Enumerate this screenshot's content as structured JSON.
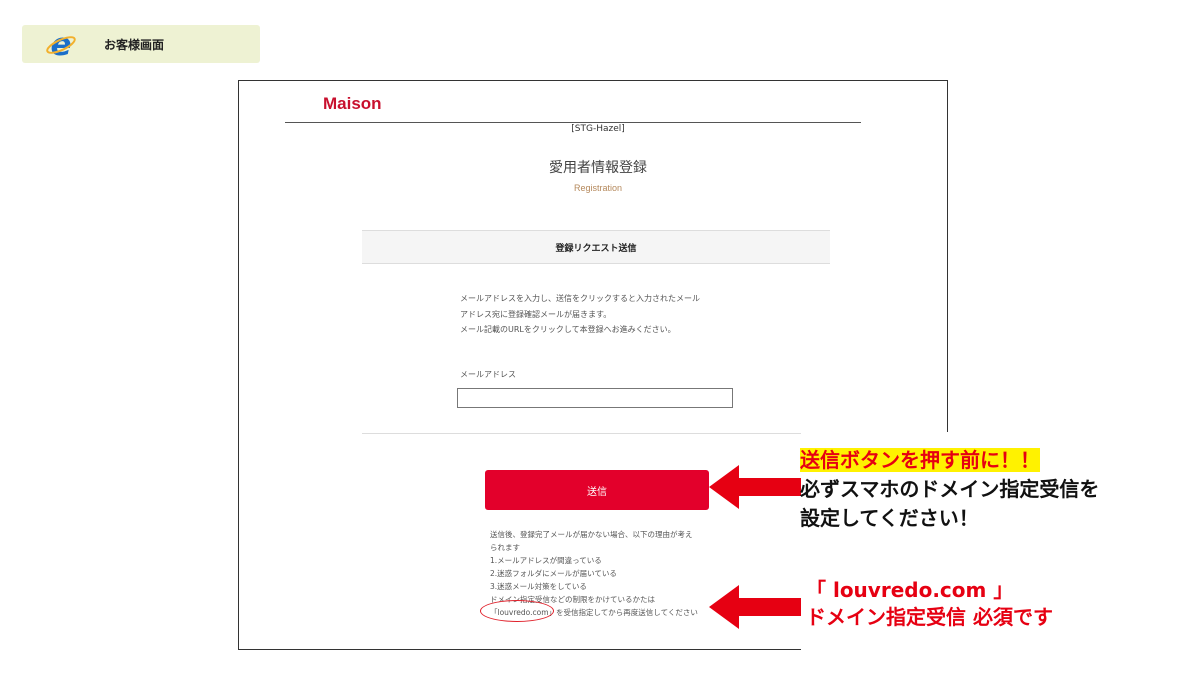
{
  "banner": {
    "title": "お客様画面",
    "icon": "internet-explorer-icon"
  },
  "page": {
    "brand": "Maison",
    "env_label": "[STG-Hazel]",
    "title": "愛用者情報登録",
    "subtitle": "Registration",
    "section_header": "登録リクエスト送信",
    "instructions": [
      "メールアドレスを入力し、送信をクリックすると入力されたメール",
      "アドレス宛に登録確認メールが届きます。",
      "メール記載のURLをクリックして本登録へお進みください。"
    ],
    "email_label": "メールアドレス",
    "email_value": "",
    "submit_label": "送信",
    "notes": [
      "送信後、登録完了メールが届かない場合、以下の理由が考え",
      "られます",
      "1.メールアドレスが間違っている",
      "2.迷惑フォルダにメールが届いている",
      "3.迷惑メール対策をしている",
      "ドメイン指定受信などの制限をかけているかたは",
      "「louvredo.com」を受信指定してから再度送信してください"
    ]
  },
  "callouts": {
    "first": {
      "highlight": "送信ボタンを押す前に！！",
      "line2": "必ずスマホのドメイン指定受信を",
      "line3": "設定してください！"
    },
    "second": {
      "line1": "「 louvredo.com 」",
      "line2": "ドメイン指定受信 必須です"
    }
  },
  "colors": {
    "accent_red": "#e3002b",
    "highlight_yellow": "#fff200",
    "banner_bg": "#eef2d3",
    "subtitle_gold": "#b5895c"
  }
}
